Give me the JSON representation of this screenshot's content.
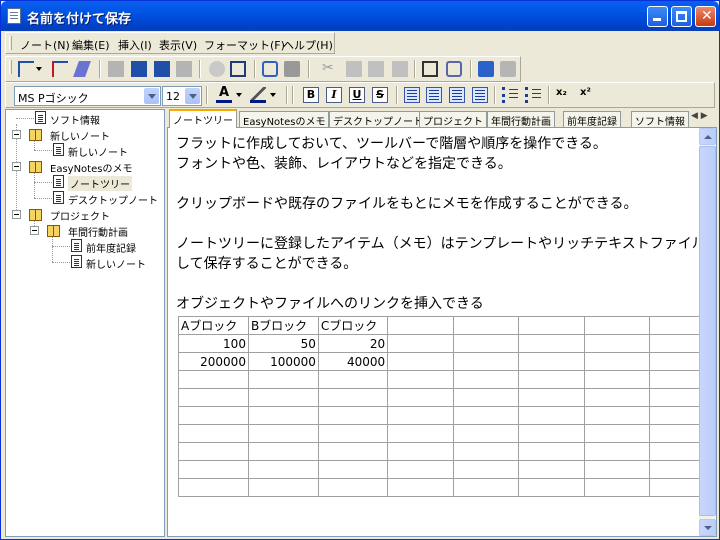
{
  "window": {
    "title": "名前を付けて保存"
  },
  "menu": [
    "ノート(N)",
    "編集(E)",
    "挿入(I)",
    "表示(V)",
    "フォーマット(F)",
    "ヘルプ(H)"
  ],
  "format": {
    "font": "MS Pゴシック",
    "size": "12",
    "bold": "B",
    "italic": "I",
    "underline": "U",
    "strike": "S",
    "subscript": "x₂",
    "superscript": "x²"
  },
  "tree": [
    {
      "label": "ソフト情報"
    },
    {
      "label": "新しいノート"
    },
    {
      "label": "新しいノート"
    },
    {
      "label": "EasyNotesのメモ"
    },
    {
      "label": "ノートツリー"
    },
    {
      "label": "デスクトップノート"
    },
    {
      "label": "プロジェクト"
    },
    {
      "label": "年間行動計画"
    },
    {
      "label": "前年度記録"
    },
    {
      "label": "新しいノート"
    }
  ],
  "tabs": [
    "ノートツリー",
    "EasyNotesのメモ",
    "デスクトップノート",
    "プロジェクト",
    "年間行動計画",
    "前年度記録",
    "ソフト情報"
  ],
  "content": {
    "paragraphs": [
      "フラットに作成しておいて、ツールバーで階層や順序を操作できる。",
      "フォントや色、装飾、レイアウトなどを指定できる。",
      "クリップボードや既存のファイルをもとにメモを作成することができる。",
      "ノートツリーに登録したアイテム（メモ）はテンプレートやリッチテキストファイルと",
      "して保存することができる。",
      "オブジェクトやファイルへのリンクを挿入できる"
    ],
    "table": [
      [
        "Aブロック",
        "Bブロック",
        "Cブロック",
        "",
        "",
        "",
        "",
        ""
      ],
      [
        "100",
        "50",
        "20",
        "",
        "",
        "",
        "",
        ""
      ],
      [
        "200000",
        "100000",
        "40000",
        "",
        "",
        "",
        "",
        ""
      ]
    ],
    "empty_rows": 7
  }
}
